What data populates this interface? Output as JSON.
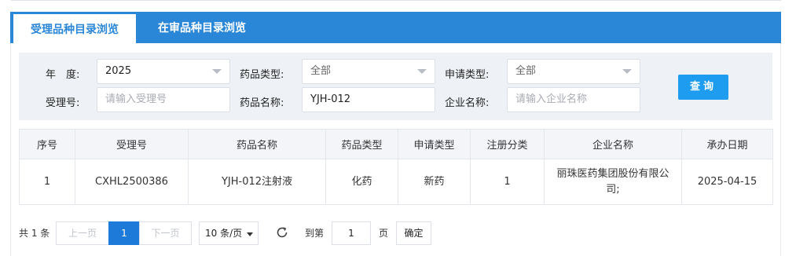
{
  "tabs": {
    "active": "受理品种目录浏览",
    "inactive": "在审品种目录浏览"
  },
  "filters": {
    "year_label": "年　度:",
    "year_value": "2025",
    "drug_type_label": "药品类型:",
    "drug_type_value": "全部",
    "apply_type_label": "申请类型:",
    "apply_type_value": "全部",
    "accept_no_label": "受理号:",
    "accept_no_placeholder": "请输入受理号",
    "drug_name_label": "药品名称:",
    "drug_name_value": "YJH-012",
    "company_label": "企业名称:",
    "company_placeholder": "请输入企业名称",
    "query_button": "查询"
  },
  "table": {
    "headers": [
      "序号",
      "受理号",
      "药品名称",
      "药品类型",
      "申请类型",
      "注册分类",
      "企业名称",
      "承办日期"
    ],
    "rows": [
      [
        "1",
        "CXHL2500386",
        "YJH-012注射液",
        "化药",
        "新药",
        "1",
        "丽珠医药集团股份有限公司;",
        "2025-04-15"
      ]
    ]
  },
  "pager": {
    "total": "共 1 条",
    "prev": "上一页",
    "current_page": "1",
    "next": "下一页",
    "page_size": "10 条/页",
    "goto_label": "到第",
    "goto_value": "1",
    "page_unit": "页",
    "confirm": "确定"
  },
  "colors": {
    "tab_bar": "#2a86d6",
    "query_button": "#1e9cf0",
    "current_page": "#1e7ad8"
  },
  "icons": {
    "refresh": "refresh-icon",
    "dropdown": "chevron-down-icon"
  }
}
